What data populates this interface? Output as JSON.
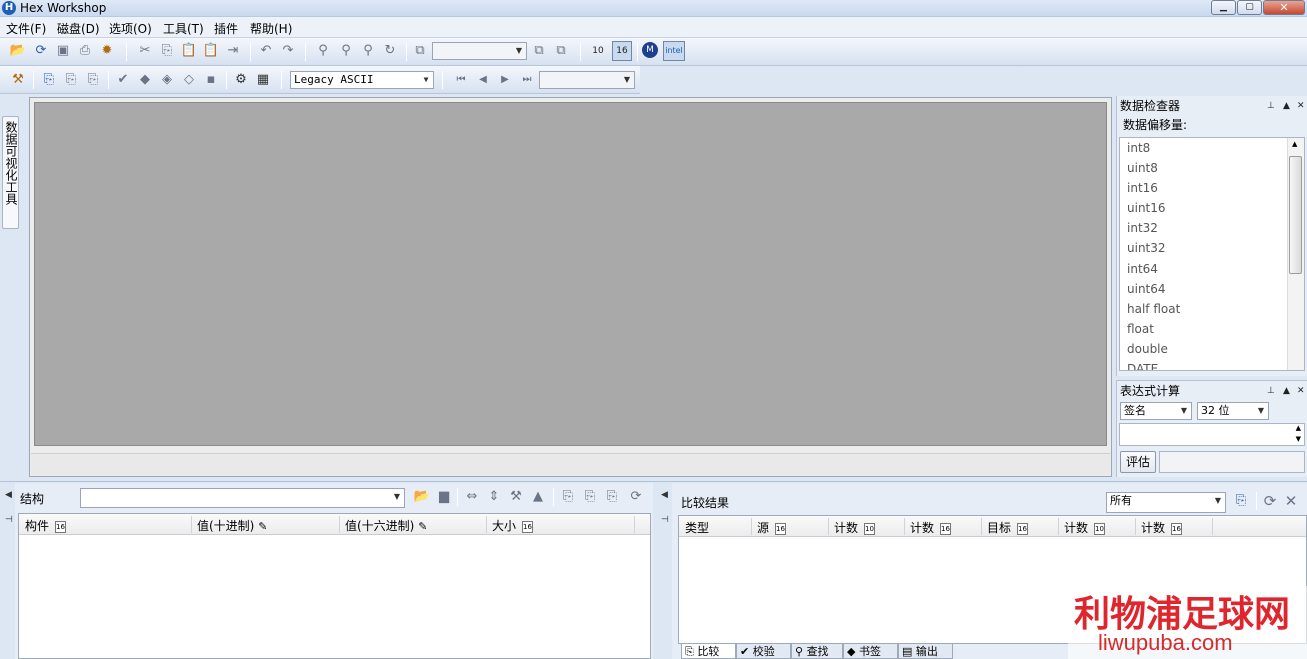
{
  "window": {
    "title": "Hex Workshop",
    "app_icon": "H"
  },
  "menu": [
    "文件(F)",
    "磁盘(D)",
    "选项(O)",
    "工具(T)",
    "插件",
    "帮助(H)"
  ],
  "toolbar2": {
    "encoding": "Legacy ASCII"
  },
  "left_tab": "数据可视化工具",
  "inspector": {
    "title": "数据检查器",
    "offset_label": "数据偏移量:",
    "types": [
      "int8",
      "uint8",
      "int16",
      "uint16",
      "int32",
      "uint32",
      "int64",
      "uint64",
      "half float",
      "float",
      "double",
      "DATE"
    ]
  },
  "expr": {
    "title": "表达式计算",
    "sign": "签名",
    "bits": "32 位",
    "eval_button": "评估"
  },
  "structure": {
    "title": "结构",
    "columns": [
      "构件",
      "值(十进制)",
      "值(十六进制)",
      "大小"
    ]
  },
  "compare": {
    "title": "比较结果",
    "filter": "所有",
    "columns": [
      "类型",
      "源",
      "计数",
      "计数",
      "目标",
      "计数",
      "计数"
    ]
  },
  "bottom_tabs": [
    "比较",
    "校验",
    "查找",
    "书签",
    "输出"
  ],
  "watermark": {
    "cn": "利物浦足球网",
    "en": "liwupuba.com"
  },
  "icons": {
    "open": "open-folder-icon",
    "save": "save-icon",
    "cut": "cut-icon",
    "copy": "copy-icon",
    "paste": "paste-icon",
    "undo": "undo-icon",
    "redo": "redo-icon",
    "find": "find-icon",
    "settings": "gear-icon",
    "calculator": "calculator-icon"
  }
}
